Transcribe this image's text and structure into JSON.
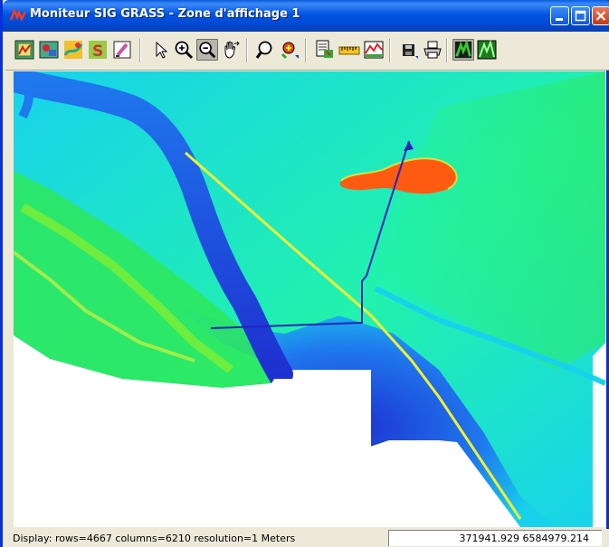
{
  "window": {
    "title": "Moniteur SIG GRASS - Zone d'affichage 1"
  },
  "title_buttons": [
    "minimize-icon",
    "maximize-icon",
    "close-icon"
  ],
  "toolbar": {
    "tools": [
      {
        "name": "display-map-icon",
        "pressed": false
      },
      {
        "name": "add-raster-icon",
        "pressed": false
      },
      {
        "name": "add-vector-icon",
        "pressed": false
      },
      {
        "name": "add-overlay-icon",
        "pressed": false
      },
      {
        "name": "erase-icon",
        "pressed": false
      },
      {
        "name": "pointer-icon",
        "pressed": false
      },
      {
        "name": "zoom-in-icon",
        "pressed": false
      },
      {
        "name": "zoom-out-icon",
        "pressed": true
      },
      {
        "name": "pan-icon",
        "pressed": false
      },
      {
        "name": "zoom-back-icon",
        "pressed": false
      },
      {
        "name": "zoom-menu-icon",
        "pressed": false
      },
      {
        "name": "query-icon",
        "pressed": false
      },
      {
        "name": "measure-icon",
        "pressed": false
      },
      {
        "name": "profile-icon",
        "pressed": false
      },
      {
        "name": "save-icon",
        "pressed": false
      },
      {
        "name": "print-icon",
        "pressed": false
      },
      {
        "name": "explore-mode-icon",
        "pressed": true
      },
      {
        "name": "constrain-mode-icon",
        "pressed": false
      }
    ]
  },
  "map": {
    "colormap": [
      "#1e2fd0",
      "#1f78ee",
      "#18d2ec",
      "#22f2ac",
      "#2ee85a",
      "#8cf02c",
      "#eef034",
      "#ff5a12"
    ]
  },
  "status": {
    "display_info": "Display: rows=4667  columns=6210  resolution=1 Meters",
    "coordinates": "371941.929  6584979.214"
  }
}
